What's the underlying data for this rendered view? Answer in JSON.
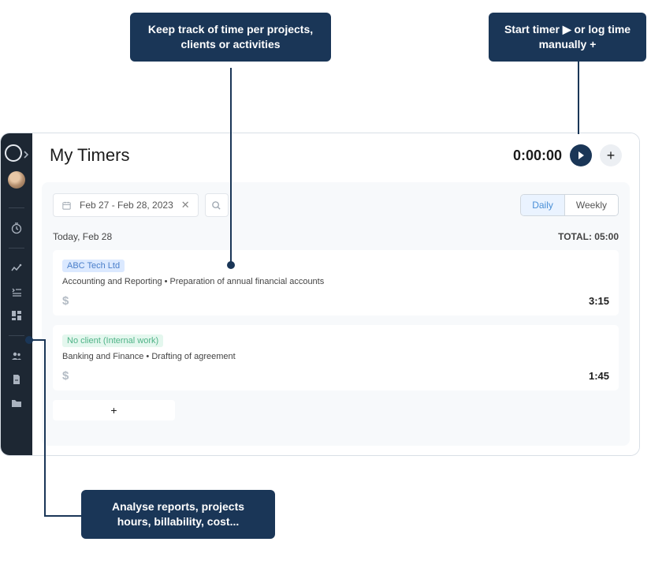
{
  "callouts": {
    "top1": "Keep track of time per projects, clients or activities",
    "top2": "Start timer ▶ or log time manually  +",
    "bottom": "Analyse reports, projects hours,  billability, cost..."
  },
  "header": {
    "title": "My Timers",
    "timer": "0:00:00"
  },
  "toolbar": {
    "date_range": "Feb 27 - Feb 28, 2023",
    "view_daily": "Daily",
    "view_weekly": "Weekly"
  },
  "day": {
    "label": "Today, Feb 28",
    "total_label": "TOTAL: 05:00"
  },
  "entries": [
    {
      "client": "ABC Tech Ltd",
      "client_class": "blue",
      "desc": "Accounting and Reporting • Preparation of annual financial accounts",
      "dollar": "$",
      "time": "3:15"
    },
    {
      "client": "No client (Internal work)",
      "client_class": "green",
      "desc": "Banking and Finance • Drafting of agreement",
      "dollar": "$",
      "time": "1:45"
    }
  ],
  "add_label": "+"
}
